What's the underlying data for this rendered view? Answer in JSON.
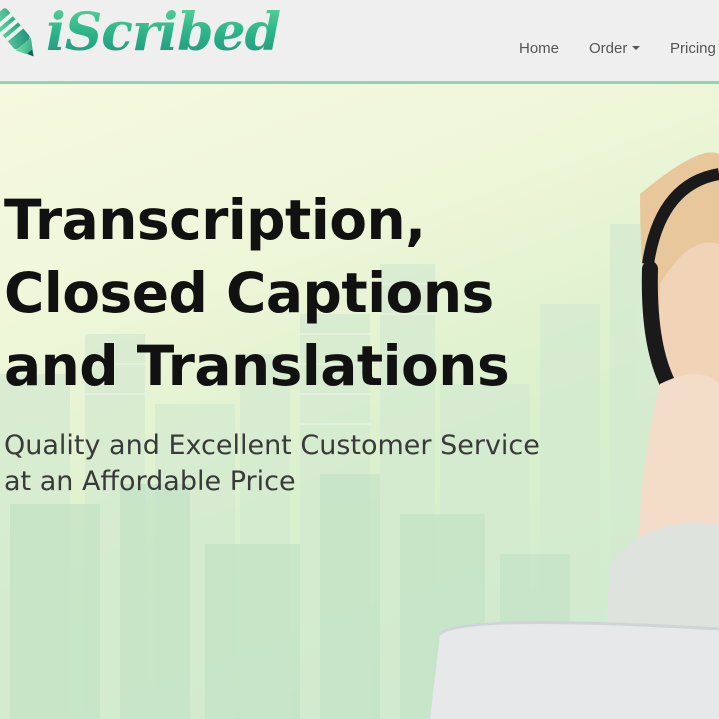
{
  "brand": {
    "logo_text": "iScribed"
  },
  "nav": {
    "items": [
      {
        "label": "Home"
      },
      {
        "label": "Order",
        "has_dropdown": true
      },
      {
        "label": "Pricing"
      }
    ]
  },
  "hero": {
    "title_lines": [
      "Transcription,",
      "Closed Captions",
      "and Translations"
    ],
    "subtitle_lines": [
      "Quality and Excellent Customer Service",
      "at an Affordable Price"
    ]
  },
  "colors": {
    "brand_green": "#2fb88a",
    "header_bg": "#efefef",
    "header_border": "#8fd6b0",
    "title_text": "#111111",
    "nav_text": "#555555"
  },
  "icons": [
    "pen-icon",
    "caret-down-icon"
  ]
}
